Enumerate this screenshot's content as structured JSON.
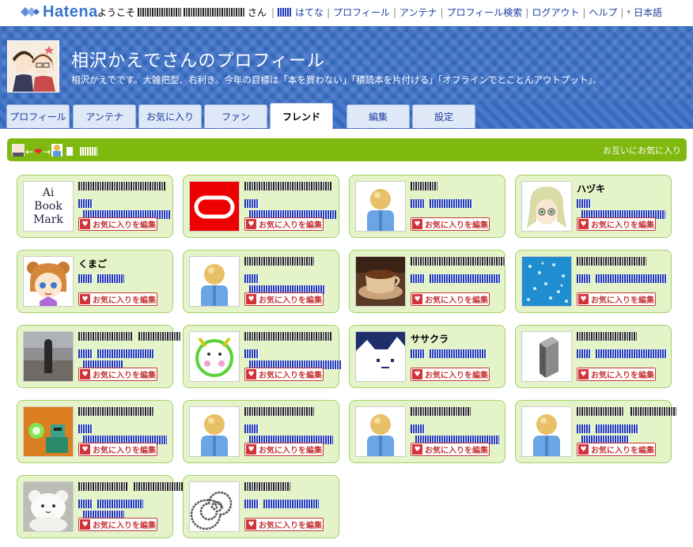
{
  "topbar": {
    "logo": "Hatena",
    "welcome_prefix": "ようこそ",
    "welcome_suffix": "さん",
    "nav": [
      {
        "label": "はてな",
        "id": "hatena"
      },
      {
        "label": "プロフィール",
        "id": "profile"
      },
      {
        "label": "アンテナ",
        "id": "antenna"
      },
      {
        "label": "プロフィール検索",
        "id": "search"
      },
      {
        "label": "ログアウト",
        "id": "logout"
      },
      {
        "label": "ヘルプ",
        "id": "help"
      },
      {
        "label": "日本語",
        "id": "language"
      }
    ]
  },
  "header": {
    "title": "相沢かえでさんのプロフィール",
    "description": "相沢かえでです。大雑把型、右利き。今年の目標は「本を買わない」「積読本を片付ける」「オフラインでとことんアウトプット」。"
  },
  "tabs": [
    {
      "label": "プロフィール",
      "active": false
    },
    {
      "label": "アンテナ",
      "active": false
    },
    {
      "label": "お気に入り",
      "active": false
    },
    {
      "label": "ファン",
      "active": false
    },
    {
      "label": "フレンド",
      "active": true
    },
    {
      "label": "編集",
      "active": false
    },
    {
      "label": "設定",
      "active": false
    }
  ],
  "friend_bar": {
    "mutual_label": "お互いにお気に入り"
  },
  "edit_label": "お気に入りを編集",
  "friends": [
    {
      "name": "",
      "avatar": "bookmark"
    },
    {
      "name": "",
      "avatar": "red-o"
    },
    {
      "name": "",
      "avatar": "default"
    },
    {
      "name": "ハヅキ",
      "avatar": "anime-girl"
    },
    {
      "name": "くまご",
      "avatar": "bear-girl"
    },
    {
      "name": "",
      "avatar": "default"
    },
    {
      "name": "",
      "avatar": "coffee"
    },
    {
      "name": "",
      "avatar": "fish"
    },
    {
      "name": "",
      "avatar": "photo-gray"
    },
    {
      "name": "",
      "avatar": "green-face"
    },
    {
      "name": "ササクラ",
      "avatar": "white-cat"
    },
    {
      "name": "",
      "avatar": "server"
    },
    {
      "name": "",
      "avatar": "robot"
    },
    {
      "name": "",
      "avatar": "default"
    },
    {
      "name": "",
      "avatar": "default"
    },
    {
      "name": "",
      "avatar": "default"
    },
    {
      "name": "",
      "avatar": "plush"
    },
    {
      "name": "",
      "avatar": "spiral"
    }
  ],
  "colors": {
    "header_blue": "#3a6fc7",
    "bar_green": "#7fb80e",
    "card_bg": "#e5f4c8",
    "edit_red": "#c63838",
    "link_blue": "#1a3fa0"
  }
}
